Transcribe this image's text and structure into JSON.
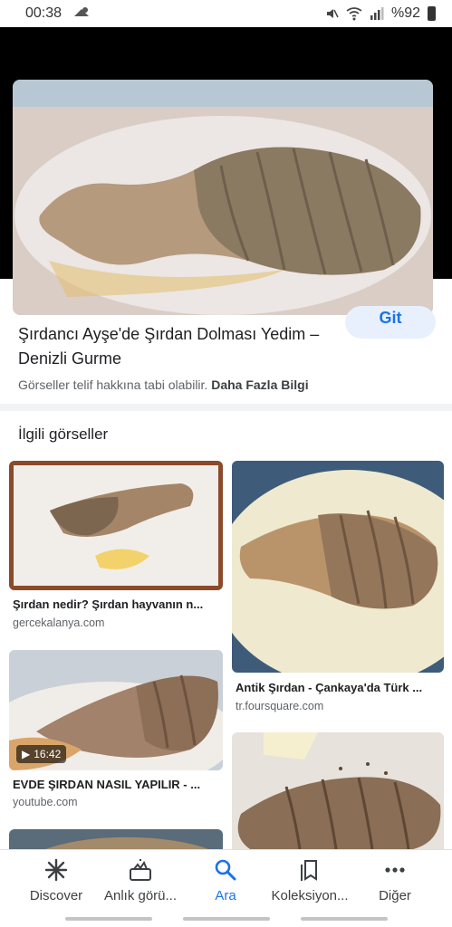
{
  "status_bar": {
    "time": "00:38",
    "battery": "%92",
    "icons": [
      "weather-icon",
      "mute-icon",
      "wifi-icon",
      "signal-icon",
      "battery-icon"
    ]
  },
  "hero": {
    "visit_label": "Git"
  },
  "result": {
    "title": "Şırdancı Ayşe'de Şırdan Dolması Yedim – Denizli Gurme",
    "copyright_text": "Görseller telif hakkına tabi olabilir.",
    "more_info_label": "Daha Fazla Bilgi"
  },
  "related": {
    "header": "İlgili görseller",
    "items": [
      {
        "title": "Şırdan nedir? Şırdan hayvanın n...",
        "source": "gercekalanya.com"
      },
      {
        "title": "Antik Şırdan - Çankaya'da Türk ...",
        "source": "tr.foursquare.com"
      },
      {
        "title": "EVDE ŞIRDAN NASIL YAPILIR - ...",
        "source": "youtube.com",
        "duration": "16:42"
      },
      {
        "title": "",
        "source": ""
      }
    ]
  },
  "bottom_nav": {
    "items": [
      {
        "label": "Discover",
        "icon": "discover-icon"
      },
      {
        "label": "Anlık görü...",
        "icon": "updates-icon"
      },
      {
        "label": "Ara",
        "icon": "search-icon",
        "active": true
      },
      {
        "label": "Koleksiyon...",
        "icon": "collections-icon"
      },
      {
        "label": "Diğer",
        "icon": "more-icon"
      }
    ]
  },
  "colors": {
    "accent": "#1a73e8",
    "hero_bg": "#000000"
  }
}
